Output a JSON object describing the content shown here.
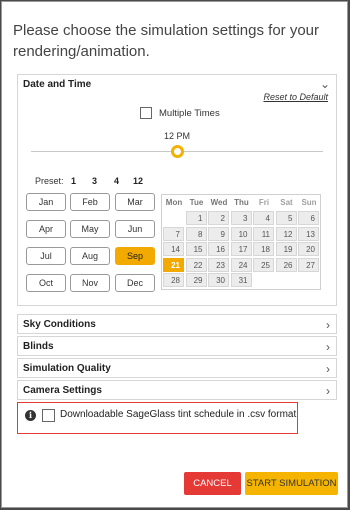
{
  "dialog": {
    "heading": "Please choose the simulation settings for your rendering/animation."
  },
  "date_time": {
    "title": "Date and Time",
    "reset_label": "Reset to Default",
    "multiple_times_label": "Multiple Times",
    "multiple_times_checked": false,
    "time_label": "12 PM",
    "time_fraction": 0.5,
    "preset_label": "Preset:",
    "presets": [
      "1",
      "3",
      "4",
      "12"
    ],
    "months": [
      "Jan",
      "Feb",
      "Mar",
      "Apr",
      "May",
      "Jun",
      "Jul",
      "Aug",
      "Sep",
      "Oct",
      "Nov",
      "Dec"
    ],
    "selected_month": "Sep",
    "calendar": {
      "weekday_headers": [
        "Mon",
        "Tue",
        "Wed",
        "Thu",
        "Fri",
        "Sat",
        "Sun"
      ],
      "weeks": [
        [
          "",
          "1",
          "2",
          "3",
          "4",
          "5",
          "6"
        ],
        [
          "7",
          "8",
          "9",
          "10",
          "11",
          "12",
          "13"
        ],
        [
          "14",
          "15",
          "16",
          "17",
          "18",
          "19",
          "20"
        ],
        [
          "21",
          "22",
          "23",
          "24",
          "25",
          "26",
          "27"
        ],
        [
          "28",
          "29",
          "30",
          "31",
          "",
          "",
          ""
        ]
      ],
      "selected_day": "21"
    }
  },
  "sections": {
    "sky": "Sky Conditions",
    "blinds": "Blinds",
    "quality": "Simulation Quality",
    "camera": "Camera Settings"
  },
  "download": {
    "info_icon": "i",
    "label": "Downloadable SageGlass tint schedule in .csv format",
    "checked": false
  },
  "buttons": {
    "cancel": "CANCEL",
    "start": "START SIMULATION"
  },
  "colors": {
    "accent": "#f2a900",
    "cancel": "#e53935",
    "highlight_border": "#e53935"
  }
}
